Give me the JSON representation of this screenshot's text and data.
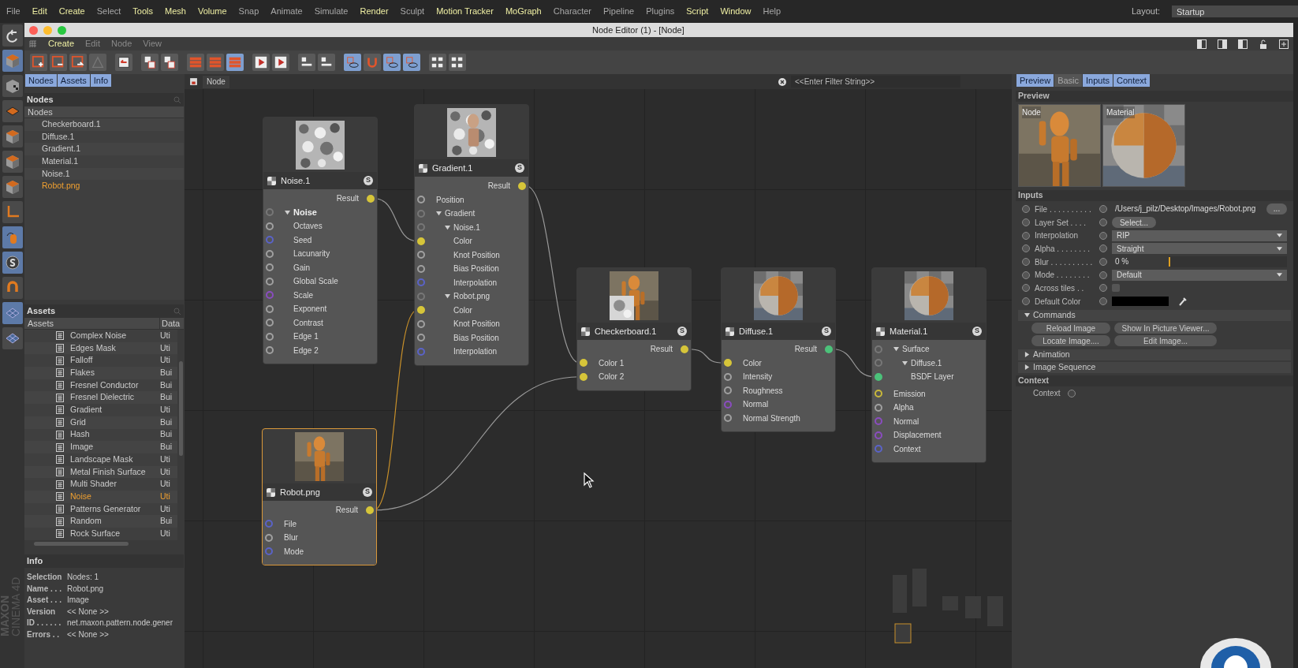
{
  "menu_bar": {
    "items": [
      {
        "label": "File",
        "highlighted": false
      },
      {
        "label": "Edit",
        "highlighted": true
      },
      {
        "label": "Create",
        "highlighted": true
      },
      {
        "label": "Select",
        "highlighted": false
      },
      {
        "label": "Tools",
        "highlighted": true
      },
      {
        "label": "Mesh",
        "highlighted": true
      },
      {
        "label": "Volume",
        "highlighted": true
      },
      {
        "label": "Snap",
        "highlighted": false
      },
      {
        "label": "Animate",
        "highlighted": false
      },
      {
        "label": "Simulate",
        "highlighted": false
      },
      {
        "label": "Render",
        "highlighted": true
      },
      {
        "label": "Sculpt",
        "highlighted": false
      },
      {
        "label": "Motion Tracker",
        "highlighted": true
      },
      {
        "label": "MoGraph",
        "highlighted": true
      },
      {
        "label": "Character",
        "highlighted": false
      },
      {
        "label": "Pipeline",
        "highlighted": false
      },
      {
        "label": "Plugins",
        "highlighted": false
      },
      {
        "label": "Script",
        "highlighted": true
      },
      {
        "label": "Window",
        "highlighted": true
      },
      {
        "label": "Help",
        "highlighted": false
      }
    ],
    "layout_label": "Layout:",
    "layout_value": "Startup"
  },
  "window": {
    "title": "Node Editor (1) - [Node]",
    "menu": [
      {
        "label": "Create",
        "highlighted": true
      },
      {
        "label": "Edit",
        "highlighted": false
      },
      {
        "label": "Node",
        "highlighted": false
      },
      {
        "label": "View",
        "highlighted": false
      }
    ],
    "toolbar_buttons": [
      {
        "on": false
      },
      {
        "on": false
      },
      {
        "on": false
      },
      {
        "on": false
      },
      {
        "on": false
      },
      {
        "on": false
      },
      {
        "on": false
      },
      {
        "on": false
      },
      {
        "on": false
      },
      {
        "on": true
      },
      {
        "on": false
      },
      {
        "on": false
      },
      {
        "on": false
      },
      {
        "on": false
      },
      {
        "on": true
      },
      {
        "on": false
      },
      {
        "on": true
      },
      {
        "on": true
      },
      {
        "on": false
      },
      {
        "on": false
      }
    ]
  },
  "left_panel": {
    "tabs": [
      {
        "label": "Nodes",
        "selected": true
      },
      {
        "label": "Assets",
        "selected": true
      },
      {
        "label": "Info",
        "selected": true
      }
    ],
    "nodes": {
      "title": "Nodes",
      "column": "Nodes",
      "items": [
        {
          "label": "Checkerboard.1",
          "selected": false
        },
        {
          "label": "Diffuse.1",
          "selected": false
        },
        {
          "label": "Gradient.1",
          "selected": false
        },
        {
          "label": "Material.1",
          "selected": false
        },
        {
          "label": "Noise.1",
          "selected": false
        },
        {
          "label": "Robot.png",
          "selected": true
        }
      ]
    },
    "assets": {
      "title": "Assets",
      "columns": [
        "Assets",
        "Data"
      ],
      "rows": [
        {
          "name": "Complex Noise",
          "data": "Uti",
          "selected": false
        },
        {
          "name": "Edges Mask",
          "data": "Uti",
          "selected": false
        },
        {
          "name": "Falloff",
          "data": "Uti",
          "selected": false
        },
        {
          "name": "Flakes",
          "data": "Bui",
          "selected": false
        },
        {
          "name": "Fresnel Conductor",
          "data": "Bui",
          "selected": false
        },
        {
          "name": "Fresnel Dielectric",
          "data": "Bui",
          "selected": false
        },
        {
          "name": "Gradient",
          "data": "Uti",
          "selected": false
        },
        {
          "name": "Grid",
          "data": "Bui",
          "selected": false
        },
        {
          "name": "Hash",
          "data": "Bui",
          "selected": false
        },
        {
          "name": "Image",
          "data": "Bui",
          "selected": false
        },
        {
          "name": "Landscape Mask",
          "data": "Uti",
          "selected": false
        },
        {
          "name": "Metal Finish Surface",
          "data": "Uti",
          "selected": false
        },
        {
          "name": "Multi Shader",
          "data": "Uti",
          "selected": false
        },
        {
          "name": "Noise",
          "data": "Uti",
          "selected": true
        },
        {
          "name": "Patterns Generator",
          "data": "Uti",
          "selected": false
        },
        {
          "name": "Random",
          "data": "Bui",
          "selected": false
        },
        {
          "name": "Rock Surface",
          "data": "Uti",
          "selected": false
        }
      ]
    },
    "info": {
      "title": "Info",
      "rows": [
        {
          "label": "Selection",
          "value": "Nodes: 1"
        },
        {
          "label": "Name . . .",
          "value": "Robot.png"
        },
        {
          "label": "Asset . . .",
          "value": "Image"
        },
        {
          "label": "Version",
          "value": "<< None >>"
        },
        {
          "label": "ID . . . . . .",
          "value": "net.maxon.pattern.node.gener"
        },
        {
          "label": "Errors . .",
          "value": "<< None >>"
        }
      ]
    }
  },
  "brand": [
    "MAXON",
    "CINEMA 4D"
  ],
  "canvas": {
    "breadcrumb": "Node",
    "filter_placeholder": "<<Enter Filter String>>",
    "nodes": [
      {
        "name": "Noise.1",
        "badge": "S",
        "selected": false,
        "output": {
          "label": "Result",
          "color": "#d6c53a",
          "connected": true
        },
        "inputs": [
          {
            "label": "Noise",
            "kind": "section",
            "color": "#777777",
            "connected": false,
            "expanded": true,
            "children": [
              {
                "label": "Octaves",
                "color": "#a0a0a0",
                "connected": false
              },
              {
                "label": "Seed",
                "color": "#5a63c8",
                "connected": false
              },
              {
                "label": "Lacunarity",
                "color": "#a0a0a0",
                "connected": false
              },
              {
                "label": "Gain",
                "color": "#a0a0a0",
                "connected": false
              },
              {
                "label": "Global Scale",
                "color": "#a0a0a0",
                "connected": false
              },
              {
                "label": "Scale",
                "color": "#8a4cc0",
                "connected": false
              },
              {
                "label": "Exponent",
                "color": "#a0a0a0",
                "connected": false
              },
              {
                "label": "Contrast",
                "color": "#a0a0a0",
                "connected": false
              },
              {
                "label": "Edge 1",
                "color": "#a0a0a0",
                "connected": false
              },
              {
                "label": "Edge 2",
                "color": "#a0a0a0",
                "connected": false
              }
            ]
          }
        ]
      },
      {
        "name": "Gradient.1",
        "badge": "S",
        "selected": false,
        "output": {
          "label": "Result",
          "color": "#d6c53a",
          "connected": true
        },
        "inputs": [
          {
            "label": "Position",
            "color": "#a0a0a0",
            "connected": false
          },
          {
            "label": "Gradient",
            "color": "#777777",
            "connected": false,
            "expanded": true,
            "children": [
              {
                "label": "Noise.1",
                "color": "#777777",
                "connected": false,
                "expanded": true,
                "children": [
                  {
                    "label": "Color",
                    "color": "#d6c53a",
                    "connected": true
                  },
                  {
                    "label": "Knot Position",
                    "color": "#a0a0a0",
                    "connected": false
                  },
                  {
                    "label": "Bias Position",
                    "color": "#a0a0a0",
                    "connected": false
                  },
                  {
                    "label": "Interpolation",
                    "color": "#5a63c8",
                    "connected": false
                  }
                ]
              },
              {
                "label": "Robot.png",
                "color": "#777777",
                "connected": false,
                "expanded": true,
                "children": [
                  {
                    "label": "Color",
                    "color": "#d6c53a",
                    "connected": true
                  },
                  {
                    "label": "Knot Position",
                    "color": "#a0a0a0",
                    "connected": false
                  },
                  {
                    "label": "Bias Position",
                    "color": "#a0a0a0",
                    "connected": false
                  },
                  {
                    "label": "Interpolation",
                    "color": "#5a63c8",
                    "connected": false
                  }
                ]
              }
            ]
          }
        ]
      },
      {
        "name": "Checkerboard.1",
        "badge": "S",
        "selected": false,
        "output": {
          "label": "Result",
          "color": "#d6c53a",
          "connected": true
        },
        "inputs": [
          {
            "label": "Color 1",
            "color": "#d6c53a",
            "connected": true
          },
          {
            "label": "Color 2",
            "color": "#d6c53a",
            "connected": true
          }
        ]
      },
      {
        "name": "Diffuse.1",
        "badge": "S",
        "selected": false,
        "output": {
          "label": "Result",
          "color": "#4cc27a",
          "connected": true
        },
        "inputs": [
          {
            "label": "Color",
            "color": "#d6c53a",
            "connected": true
          },
          {
            "label": "Intensity",
            "color": "#a0a0a0",
            "connected": false
          },
          {
            "label": "Roughness",
            "color": "#a0a0a0",
            "connected": false
          },
          {
            "label": "Normal",
            "color": "#8a4cc0",
            "connected": false
          },
          {
            "label": "Normal Strength",
            "color": "#a0a0a0",
            "connected": false
          }
        ]
      },
      {
        "name": "Material.1",
        "badge": "S",
        "selected": false,
        "inputs": [
          {
            "label": "Surface",
            "color": "#777777",
            "connected": false,
            "expanded": true,
            "children": [
              {
                "label": "Diffuse.1",
                "color": "#777777",
                "connected": false,
                "expanded": true,
                "children": [
                  {
                    "label": "BSDF Layer",
                    "color": "#4cc27a",
                    "connected": true
                  }
                ]
              }
            ]
          },
          {
            "label": "Emission",
            "color": "#c9b83a",
            "connected": false
          },
          {
            "label": "Alpha",
            "color": "#a0a0a0",
            "connected": false
          },
          {
            "label": "Normal",
            "color": "#8a4cc0",
            "connected": false
          },
          {
            "label": "Displacement",
            "color": "#8a4cc0",
            "connected": false
          },
          {
            "label": "Context",
            "color": "#5a63c8",
            "connected": false
          }
        ]
      },
      {
        "name": "Robot.png",
        "badge": "S",
        "selected": true,
        "output": {
          "label": "Result",
          "color": "#d6c53a",
          "connected": true
        },
        "inputs": [
          {
            "label": "File",
            "color": "#5a63c8",
            "connected": false
          },
          {
            "label": "Blur",
            "color": "#a0a0a0",
            "connected": false
          },
          {
            "label": "Mode",
            "color": "#5a63c8",
            "connected": false
          }
        ]
      }
    ]
  },
  "attributes": {
    "tabs": [
      {
        "label": "Preview",
        "selected": true
      },
      {
        "label": "Basic",
        "selected": false
      },
      {
        "label": "Inputs",
        "selected": true
      },
      {
        "label": "Context",
        "selected": true
      }
    ],
    "preview": {
      "title": "Preview",
      "images": [
        "Node",
        "Material"
      ]
    },
    "inputs_title": "Inputs",
    "inputs": [
      {
        "kind": "file",
        "label": "File . . . . . . . . . .",
        "value": "/Users/j_pilz/Desktop/Images/Robot.png",
        "button": "..."
      },
      {
        "kind": "button",
        "label": "Layer Set . . . .",
        "value": "Select..."
      },
      {
        "kind": "dropdown",
        "label": "Interpolation",
        "value": "RIP"
      },
      {
        "kind": "dropdown",
        "label": "Alpha . . . . . . . .",
        "value": "Straight"
      },
      {
        "kind": "slider",
        "label": "Blur . . . . . . . . . .",
        "value": "0 %",
        "level": 0
      },
      {
        "kind": "dropdown",
        "label": "Mode . . . . . . . .",
        "value": "Default"
      },
      {
        "kind": "checkbox",
        "label": "Across tiles . .",
        "checked": false
      },
      {
        "kind": "color",
        "label": "Default Color"
      }
    ],
    "groups": [
      {
        "title": "Commands",
        "expanded": true,
        "buttons": [
          "Reload Image",
          "Show In Picture Viewer...",
          "Locate Image....",
          "Edit Image..."
        ]
      },
      {
        "title": "Animation",
        "expanded": false
      },
      {
        "title": "Image Sequence",
        "expanded": false
      }
    ],
    "context": {
      "title": "Context",
      "label": "Context",
      "checked": false
    }
  }
}
